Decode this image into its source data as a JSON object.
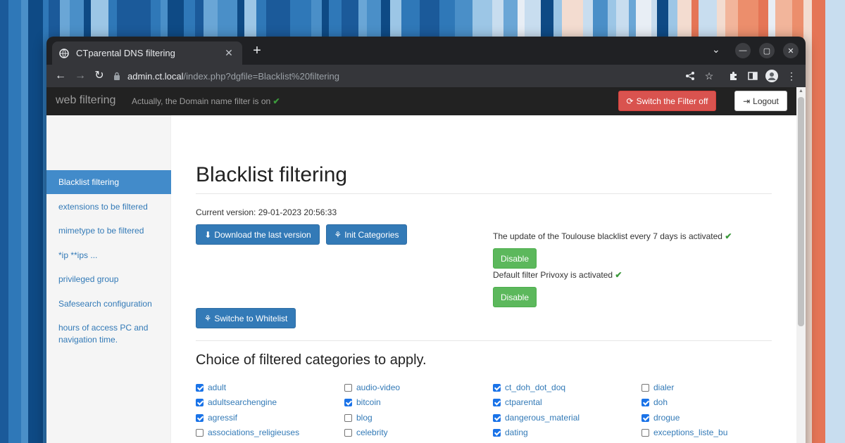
{
  "browser": {
    "tab_title": "CTparental DNS filtering",
    "url_host": "admin.ct.local",
    "url_path": "/index.php?dgfile=Blacklist%20filtering",
    "new_tab_label": "+",
    "close_tab_label": "✕"
  },
  "navbar": {
    "brand": "web filtering",
    "status": "Actually, the Domain name filter is on",
    "switch_button": "Switch the Filter off",
    "logout_button": "Logout"
  },
  "sidebar": {
    "items": [
      {
        "label": "Blacklist filtering",
        "active": true
      },
      {
        "label": "extensions to be filtered"
      },
      {
        "label": "mimetype to be filtered"
      },
      {
        "label": "*ip **ips ..."
      },
      {
        "label": "privileged group"
      },
      {
        "label": "Safesearch configuration"
      },
      {
        "label": "hours of access PC and navigation time."
      }
    ]
  },
  "main": {
    "title": "Blacklist filtering",
    "version": "Current version: 29-01-2023 20:56:33",
    "download_button": "Download the last version",
    "init_button": "Init Categories",
    "update_status": "The update of the Toulouse blacklist every 7 days is activated",
    "disable_button_1": "Disable",
    "privoxy_status": "Default filter Privoxy is activated",
    "disable_button_2": "Disable",
    "whitelist_button": "Switche to Whitelist",
    "categories_heading": "Choice of filtered categories to apply.",
    "categories": [
      {
        "label": "adult",
        "checked": true
      },
      {
        "label": "adultsearchengine",
        "checked": true
      },
      {
        "label": "agressif",
        "checked": true
      },
      {
        "label": "associations_religieuses",
        "checked": false
      },
      {
        "label": "audio-video",
        "checked": false
      },
      {
        "label": "bitcoin",
        "checked": true
      },
      {
        "label": "blog",
        "checked": false
      },
      {
        "label": "celebrity",
        "checked": false
      },
      {
        "label": "ct_doh_dot_doq",
        "checked": true
      },
      {
        "label": "ctparental",
        "checked": true
      },
      {
        "label": "dangerous_material",
        "checked": true
      },
      {
        "label": "dating",
        "checked": true
      },
      {
        "label": "dialer",
        "checked": false
      },
      {
        "label": "doh",
        "checked": true
      },
      {
        "label": "drogue",
        "checked": true
      },
      {
        "label": "exceptions_liste_bu",
        "checked": false
      }
    ]
  },
  "colors": {
    "navbar_bg": "#222222",
    "danger": "#d9534f",
    "primary": "#337ab7",
    "success": "#5cb85c",
    "active_sidebar": "#428bca"
  }
}
